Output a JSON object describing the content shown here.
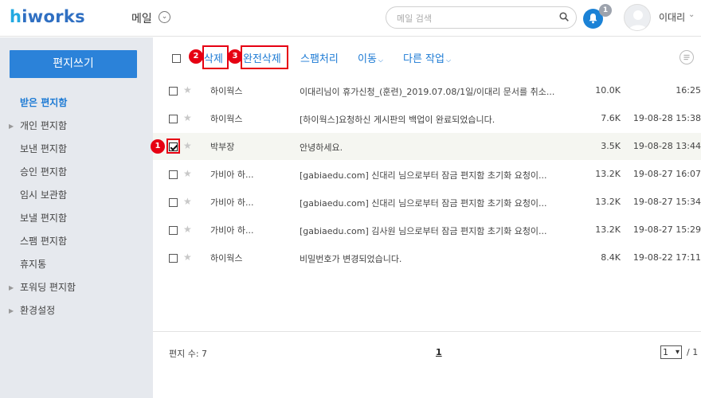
{
  "header": {
    "logo_h": "h",
    "logo_rest": "iworks",
    "app_name": "메일",
    "search_placeholder": "메일 검색",
    "notification_count": "1",
    "user_name": "이대리"
  },
  "sidebar": {
    "compose_label": "편지쓰기",
    "folders": [
      {
        "label": "받은 편지함",
        "active": true,
        "expandable": false
      },
      {
        "label": "개인 편지함",
        "active": false,
        "expandable": true
      },
      {
        "label": "보낸 편지함",
        "active": false,
        "expandable": false
      },
      {
        "label": "승인 편지함",
        "active": false,
        "expandable": false
      },
      {
        "label": "임시 보관함",
        "active": false,
        "expandable": false
      },
      {
        "label": "보낼 편지함",
        "active": false,
        "expandable": false
      },
      {
        "label": "스팸 편지함",
        "active": false,
        "expandable": false
      },
      {
        "label": "휴지통",
        "active": false,
        "expandable": false
      },
      {
        "label": "포워딩 편지함",
        "active": false,
        "expandable": true
      },
      {
        "label": "환경설정",
        "active": false,
        "expandable": true
      }
    ]
  },
  "toolbar": {
    "delete_label": "삭제",
    "delete_permanent_label": "완전삭제",
    "spam_label": "스팸처리",
    "move_label": "이동",
    "other_label": "다른 작업"
  },
  "steps": [
    "1",
    "2",
    "3"
  ],
  "accent": "#1c7ad4",
  "highlight_color": "#e60012",
  "messages": [
    {
      "from": "하이웍스",
      "subject": "이대리님이 휴가신청_(훈련)_2019.07.08/1일/이대리 문서를 취소...",
      "size": "10.0K",
      "date": "16:25",
      "checked": false
    },
    {
      "from": "하이웍스",
      "subject": "[하이웍스]요청하신 게시판의 백업이 완료되었습니다.",
      "size": "7.6K",
      "date": "19-08-28 15:38",
      "checked": false
    },
    {
      "from": "박부장",
      "subject": "안녕하세요.",
      "size": "3.5K",
      "date": "19-08-28 13:44",
      "checked": true
    },
    {
      "from": "가비아 하...",
      "subject": "[gabiaedu.com] 신대리 님으로부터 잠금 편지함 초기화 요청이...",
      "size": "13.2K",
      "date": "19-08-27 16:07",
      "checked": false
    },
    {
      "from": "가비아 하...",
      "subject": "[gabiaedu.com] 신대리 님으로부터 잠금 편지함 초기화 요청이...",
      "size": "13.2K",
      "date": "19-08-27 15:34",
      "checked": false
    },
    {
      "from": "가비아 하...",
      "subject": "[gabiaedu.com] 김사원 님으로부터 잠금 편지함 초기화 요청이...",
      "size": "13.2K",
      "date": "19-08-27 15:29",
      "checked": false
    },
    {
      "from": "하이웍스",
      "subject": "비밀번호가 변경되었습니다.",
      "size": "8.4K",
      "date": "19-08-22 17:11",
      "checked": false
    }
  ],
  "footer": {
    "count_label": "편지 수: 7",
    "current_page": "1",
    "page_select_value": "1",
    "page_total": "/ 1"
  }
}
